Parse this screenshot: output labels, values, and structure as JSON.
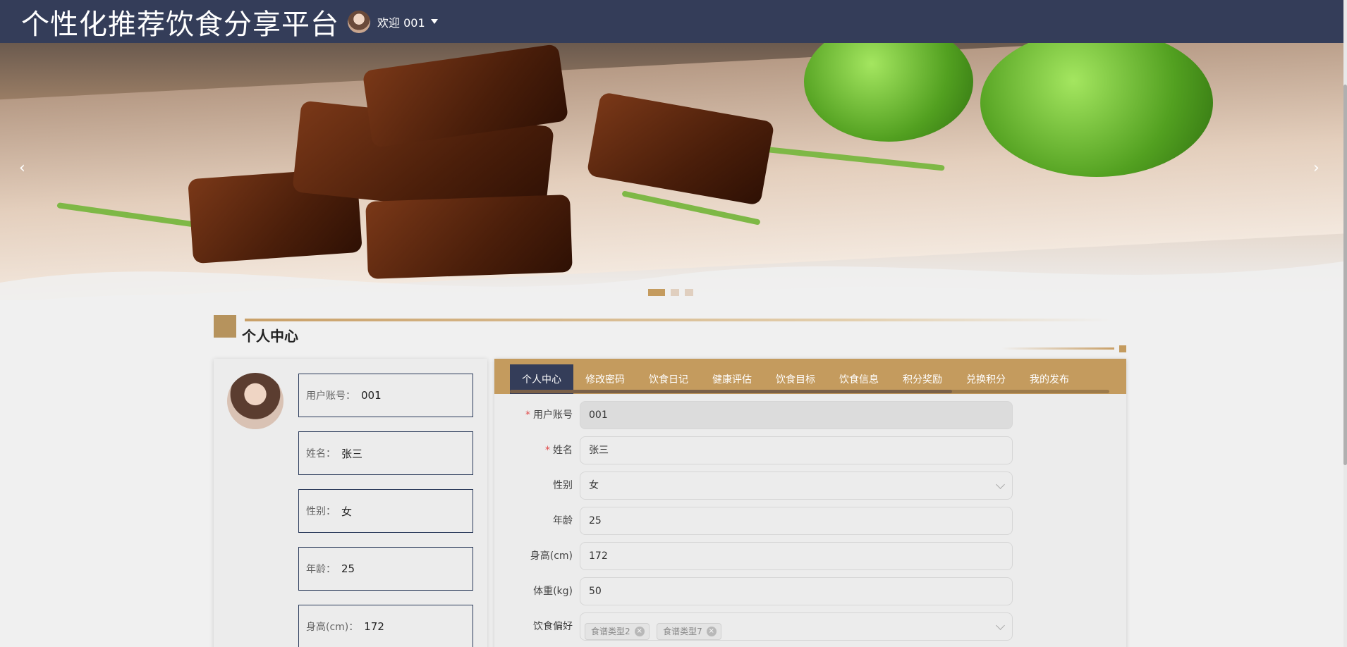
{
  "header": {
    "site_title": "个性化推荐饮食分享平台",
    "welcome_text": "欢迎 001"
  },
  "banner": {
    "prev_arrow": "‹",
    "next_arrow": "›",
    "slide_count": 3,
    "active_slide": 1
  },
  "section": {
    "title": "个人中心"
  },
  "profile_card": {
    "items": [
      {
        "label": "用户账号：",
        "value": "001"
      },
      {
        "label": "姓名：",
        "value": "张三"
      },
      {
        "label": "性别：",
        "value": "女"
      },
      {
        "label": "年龄：",
        "value": "25"
      },
      {
        "label": "身高(cm)：",
        "value": "172"
      }
    ]
  },
  "tabs": [
    {
      "label": "个人中心",
      "active": true
    },
    {
      "label": "修改密码",
      "active": false
    },
    {
      "label": "饮食日记",
      "active": false
    },
    {
      "label": "健康评估",
      "active": false
    },
    {
      "label": "饮食目标",
      "active": false
    },
    {
      "label": "饮食信息",
      "active": false
    },
    {
      "label": "积分奖励",
      "active": false
    },
    {
      "label": "兑换积分",
      "active": false
    },
    {
      "label": "我的发布",
      "active": false
    }
  ],
  "form": {
    "account": {
      "label": "用户账号",
      "value": "001",
      "required": true
    },
    "name": {
      "label": "姓名",
      "value": "张三",
      "required": true
    },
    "gender": {
      "label": "性别",
      "value": "女"
    },
    "age": {
      "label": "年龄",
      "value": "25"
    },
    "height": {
      "label": "身高(cm)",
      "value": "172"
    },
    "weight": {
      "label": "体重(kg)",
      "value": "50"
    },
    "diet_pref": {
      "label": "饮食偏好",
      "tags": [
        "食谱类型2",
        "食谱类型7"
      ]
    }
  },
  "colors": {
    "header_bg": "#343d59",
    "accent_gold": "#c49b5e",
    "required": "#e14b4b"
  }
}
